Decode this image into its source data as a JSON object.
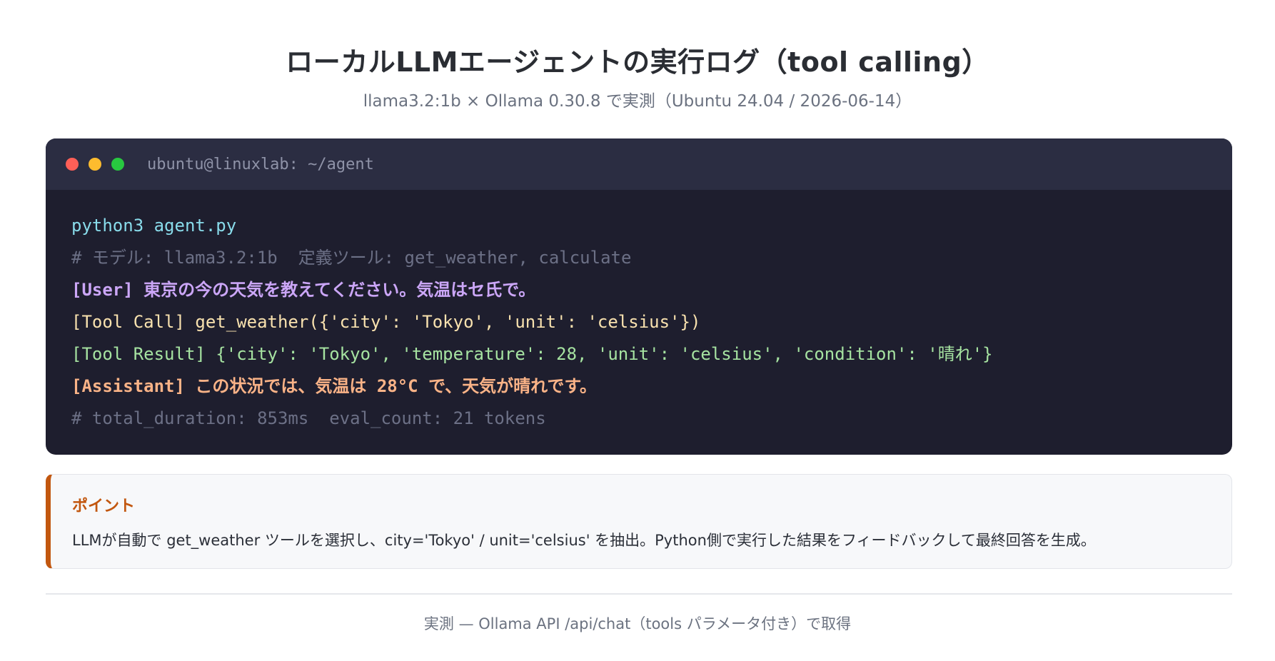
{
  "header": {
    "title": "ローカルLLMエージェントの実行ログ（tool calling）",
    "subtitle": "llama3.2:1b × Ollama 0.30.8 で実測（Ubuntu 24.04 / 2026-06-14）"
  },
  "terminal": {
    "window_title": "ubuntu@linuxlab: ~/agent",
    "lines": [
      "python3 agent.py",
      "# モデル: llama3.2:1b  定義ツール: get_weather, calculate",
      "[User] 東京の今の天気を教えてください。気温はセ氏で。",
      "[Tool Call] get_weather({'city': 'Tokyo', 'unit': 'celsius'})",
      "[Tool Result] {'city': 'Tokyo', 'temperature': 28, 'unit': 'celsius', 'condition': '晴れ'}",
      "[Assistant] この状況では、気温は 28°C で、天気が晴れです。",
      "# total_duration: 853ms  eval_count: 21 tokens"
    ],
    "colors": {
      "command": "#89dceb",
      "comment": "#6c7086",
      "user": "#cba6f7",
      "tool_call": "#f9e2af",
      "tool_result": "#a6e3a1",
      "assistant": "#fab387"
    }
  },
  "callout": {
    "title": "ポイント",
    "text": "LLMが自動で get_weather ツールを選択し、city='Tokyo' / unit='celsius' を抽出。Python側で実行した結果をフィードバックして最終回答を生成。",
    "accent": "#c2570f"
  },
  "footer": {
    "text": "実測 — Ollama API /api/chat（tools パラメータ付き）で取得"
  }
}
